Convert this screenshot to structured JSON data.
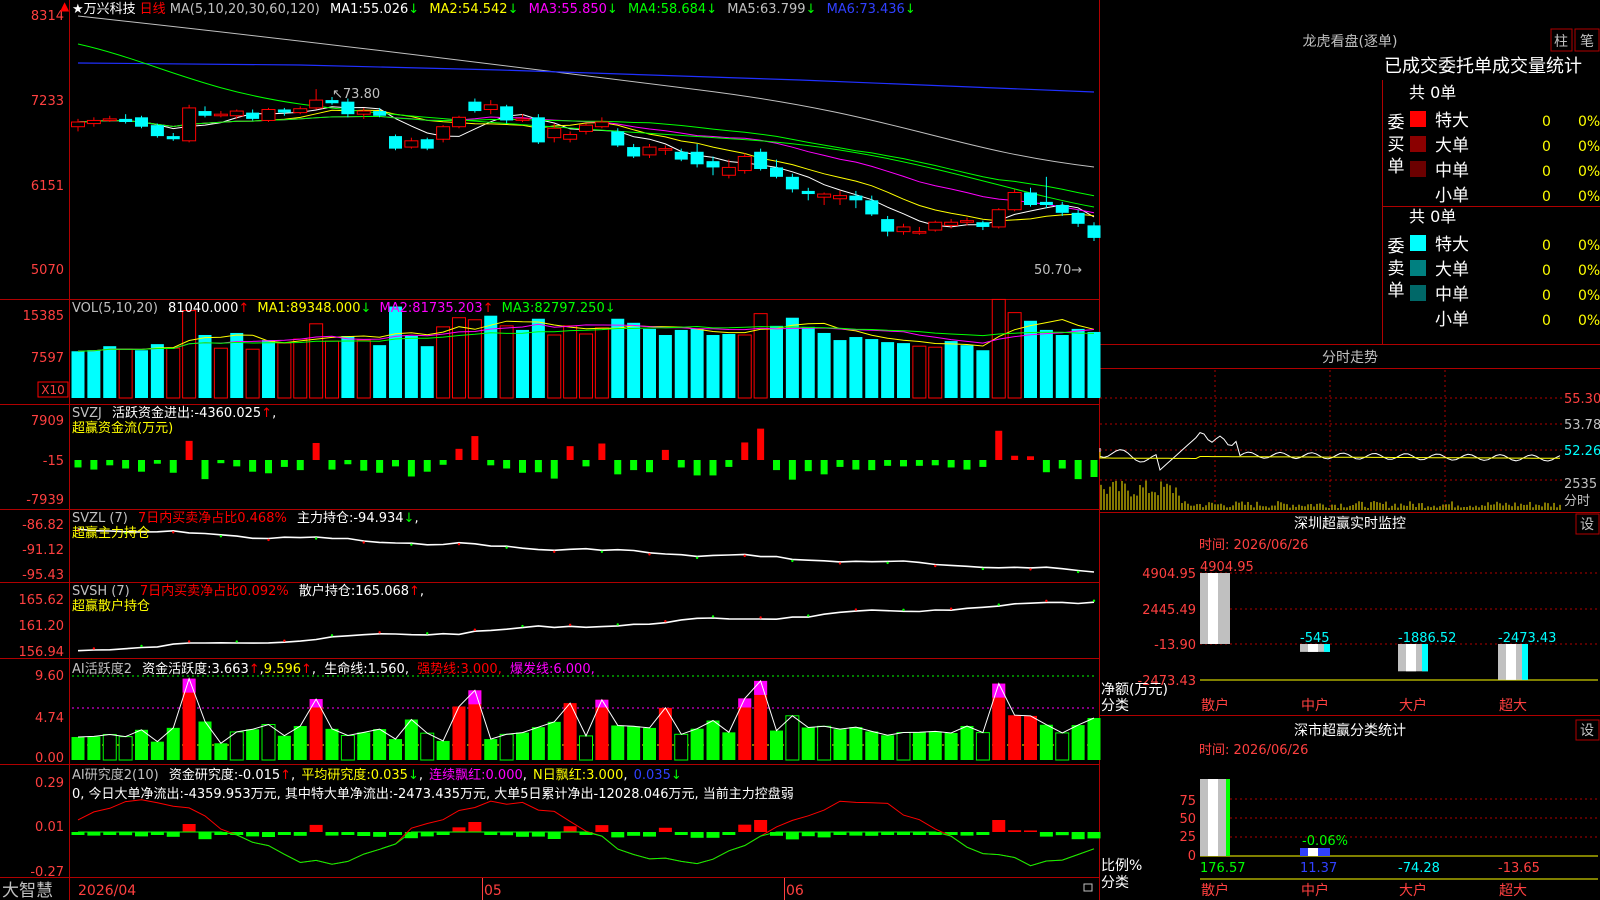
{
  "app": {
    "brand": "大智慧"
  },
  "stock": {
    "name": "万兴科技",
    "period": "日线",
    "star": "★"
  },
  "panels": {
    "price": {
      "legend_ma": "MA(5,10,20,30,60,120)",
      "ma": [
        {
          "label": "MA1:",
          "value": "55.026",
          "arrow": "↓",
          "color": "#ffffff"
        },
        {
          "label": "MA2:",
          "value": "54.542",
          "arrow": "↓",
          "color": "#ffff00"
        },
        {
          "label": "MA3:",
          "value": "55.850",
          "arrow": "↓",
          "color": "#ff00ff"
        },
        {
          "label": "MA4:",
          "value": "58.684",
          "arrow": "↓",
          "color": "#00ff00"
        },
        {
          "label": "MA5:",
          "value": "63.799",
          "arrow": "↓",
          "color": "#c0c0c0"
        },
        {
          "label": "MA6:",
          "value": "73.436",
          "arrow": "↓",
          "color": "#0000ff"
        }
      ],
      "yticks": [
        "8314",
        "7233",
        "6151",
        "5070"
      ],
      "high_note": "73.80",
      "low_note": "50.70"
    },
    "vol": {
      "legend": "VOL(5,10,20)",
      "value": "81040.000",
      "ma": [
        {
          "label": "MA1:",
          "value": "89348.000",
          "arrow": "↓",
          "color": "#ffff00"
        },
        {
          "label": "MA2:",
          "value": "81735.203",
          "arrow": "↑",
          "color": "#ff00ff"
        },
        {
          "label": "MA3:",
          "value": "82797.250",
          "arrow": "↓",
          "color": "#00ff00"
        }
      ],
      "yticks": [
        "15385",
        "7597"
      ],
      "unit": "X10"
    },
    "svzj": {
      "legend": "SVZJ",
      "label": "活跃资金进出:",
      "value": "-4360.025",
      "arrow": "↑",
      "subtitle": "超赢资金流(万元)",
      "yticks": [
        "7909",
        "-15",
        "-7939"
      ]
    },
    "svzl": {
      "legend": "SVZL (7)",
      "note": "7日内买卖净占比0.468%",
      "label": "主力持仓:",
      "value": "-94.934",
      "arrow": "↓",
      "subtitle": "超赢主力持仓",
      "yticks": [
        "-86.82",
        "-91.12",
        "-95.43"
      ]
    },
    "svsh": {
      "legend": "SVSH (7)",
      "note": "7日内买卖净占比0.092%",
      "label": "散户持仓:",
      "value": "165.068",
      "arrow": "↑",
      "subtitle": "超赢散户持仓",
      "yticks": [
        "165.62",
        "161.20",
        "156.94"
      ]
    },
    "ai_active": {
      "legend": "AI活跃度2",
      "label1": "资金活跃度:",
      "value1": "3.663",
      "arrow1": "↑",
      "value2": "9.596",
      "label3": "生命线:",
      "value3": "1.560",
      "label4": "强势线:",
      "value4": "3.000",
      "label5": "爆发线:",
      "value5": "6.000",
      "yticks": [
        "9.60",
        "4.74",
        "0.00"
      ]
    },
    "ai_research": {
      "legend": "AI研究度2(10)",
      "label1": "资金研究度:",
      "value1": "-0.015",
      "label2": "平均研究度:",
      "value2": "0.035",
      "label3": "连续飘红:",
      "value3": "0.000",
      "label4": "N日飘红:",
      "value4": "3.000",
      "value5": "0.035",
      "summary": "0, 今日大单净流出:-4359.953万元, 其中特大单净流出:-2473.435万元, 大单5日累计净出-12028.046万元, 当前主力控盘弱",
      "yticks": [
        "0.29",
        "0.01",
        "-0.27"
      ]
    }
  },
  "xaxis": [
    "2026/04",
    "05",
    "06"
  ],
  "sidebar": {
    "dragon_title": "龙虎看盘(逐单)",
    "btn_zhu": "柱",
    "btn_bi": "笔",
    "table_title": "已成交委托单成交量统计",
    "buy_label": "委买单",
    "sell_label": "委卖单",
    "buy_total": "共 0单",
    "sell_total": "共 0单",
    "rows": [
      {
        "label": "特大",
        "count": "0",
        "pct": "0%"
      },
      {
        "label": "大单",
        "count": "0",
        "pct": "0%"
      },
      {
        "label": "中单",
        "count": "0",
        "pct": "0%"
      },
      {
        "label": "小单",
        "count": "0",
        "pct": "0%"
      }
    ],
    "intraday_title": "分时走势",
    "intraday_ticks": [
      "55.30",
      "53.78",
      "52.26",
      "2535"
    ],
    "intraday_unit": "分时",
    "monitor_title": "深圳超赢实时监控",
    "monitor_btn": "设",
    "monitor_time": "时间: 2026/06/26",
    "monitor_yticks": [
      "4904.95",
      "2445.49",
      "-13.90",
      "-2473.43"
    ],
    "monitor_ylabel": "净额(万元)",
    "monitor_xlabel": "分类",
    "monitor_bars": [
      {
        "cat": "散户",
        "value": "4904.95"
      },
      {
        "cat": "中户",
        "value": "-545"
      },
      {
        "cat": "大户",
        "value": "-1886.52"
      },
      {
        "cat": "超大",
        "value": "-2473.43"
      }
    ],
    "class_title": "深市超赢分类统计",
    "class_btn": "设",
    "class_time": "时间: 2026/06/26",
    "class_yticks": [
      "75",
      "50",
      "25",
      "0"
    ],
    "class_ylabel": "比例%",
    "class_xlabel": "分类",
    "class_bars": [
      {
        "cat": "散户",
        "value": "176.57"
      },
      {
        "cat": "中户",
        "value": "11.37",
        "note": "-0.06%"
      },
      {
        "cat": "大户",
        "value": "-74.28"
      },
      {
        "cat": "超大",
        "value": "-13.65"
      }
    ]
  },
  "colors": {
    "up": "#ff0000",
    "down": "#00ffff",
    "grid": "#b00000"
  },
  "chart_data": {
    "type": "candlestick",
    "ylim": [
      50.0,
      83.14
    ],
    "candles": [
      [
        69.0,
        70.0,
        68.4,
        69.6
      ],
      [
        69.4,
        70.2,
        69.0,
        69.8
      ],
      [
        69.8,
        70.4,
        69.6,
        70.0
      ],
      [
        70.0,
        70.6,
        69.4,
        69.6
      ],
      [
        70.2,
        70.4,
        68.8,
        69.0
      ],
      [
        69.2,
        69.4,
        67.6,
        67.8
      ],
      [
        67.8,
        68.2,
        67.2,
        67.4
      ],
      [
        67.2,
        71.8,
        67.0,
        71.4
      ],
      [
        71.0,
        71.6,
        70.2,
        70.4
      ],
      [
        70.4,
        71.0,
        70.2,
        70.6
      ],
      [
        70.4,
        71.2,
        70.0,
        71.0
      ],
      [
        70.8,
        71.2,
        69.8,
        70.0
      ],
      [
        69.8,
        71.4,
        69.6,
        71.2
      ],
      [
        71.2,
        71.4,
        70.4,
        70.8
      ],
      [
        70.8,
        71.6,
        70.6,
        71.3
      ],
      [
        71.4,
        73.8,
        71.2,
        72.4
      ],
      [
        72.4,
        72.8,
        71.8,
        72.0
      ],
      [
        72.2,
        72.6,
        70.2,
        70.6
      ],
      [
        70.6,
        71.4,
        70.0,
        71.0
      ],
      [
        71.0,
        71.4,
        70.2,
        70.4
      ],
      [
        67.8,
        68.0,
        66.0,
        66.2
      ],
      [
        66.4,
        67.6,
        66.2,
        67.2
      ],
      [
        67.4,
        67.6,
        66.0,
        66.2
      ],
      [
        67.4,
        69.2,
        67.0,
        69.0
      ],
      [
        69.0,
        70.4,
        68.8,
        70.2
      ],
      [
        72.2,
        72.6,
        70.8,
        71.0
      ],
      [
        71.2,
        72.4,
        70.6,
        71.8
      ],
      [
        71.6,
        71.8,
        69.4,
        69.8
      ],
      [
        70.0,
        70.6,
        69.6,
        70.0
      ],
      [
        70.2,
        70.6,
        66.8,
        67.0
      ],
      [
        67.6,
        69.4,
        67.0,
        68.8
      ],
      [
        67.4,
        68.4,
        67.0,
        68.0
      ],
      [
        68.4,
        69.4,
        68.0,
        69.2
      ],
      [
        69.0,
        70.2,
        68.8,
        69.6
      ],
      [
        68.4,
        68.8,
        66.4,
        66.6
      ],
      [
        66.4,
        66.8,
        65.0,
        65.2
      ],
      [
        65.4,
        66.8,
        65.0,
        66.4
      ],
      [
        66.0,
        66.6,
        65.4,
        66.2
      ],
      [
        65.8,
        66.2,
        64.6,
        64.8
      ],
      [
        65.8,
        66.8,
        63.8,
        64.2
      ],
      [
        64.6,
        65.2,
        62.8,
        63.8
      ],
      [
        62.8,
        64.8,
        62.4,
        63.8
      ],
      [
        63.4,
        65.6,
        63.0,
        65.2
      ],
      [
        65.8,
        66.2,
        63.4,
        63.6
      ],
      [
        63.8,
        64.8,
        62.4,
        62.6
      ],
      [
        62.6,
        63.0,
        60.6,
        61.0
      ],
      [
        60.8,
        61.2,
        59.6,
        60.4
      ],
      [
        60.0,
        60.6,
        59.0,
        60.4
      ],
      [
        59.8,
        60.8,
        59.0,
        60.2
      ],
      [
        60.2,
        60.8,
        58.6,
        59.6
      ],
      [
        59.6,
        60.2,
        57.6,
        57.8
      ],
      [
        57.2,
        57.6,
        55.0,
        55.6
      ],
      [
        55.6,
        56.6,
        55.2,
        56.2
      ],
      [
        55.6,
        56.2,
        55.2,
        55.6
      ],
      [
        55.8,
        57.0,
        55.6,
        56.8
      ],
      [
        56.4,
        57.2,
        56.0,
        56.8
      ],
      [
        56.8,
        57.4,
        56.4,
        57.0
      ],
      [
        56.8,
        57.0,
        55.8,
        56.2
      ],
      [
        56.2,
        58.6,
        56.0,
        58.4
      ],
      [
        58.4,
        61.0,
        58.2,
        60.6
      ],
      [
        60.6,
        61.2,
        58.8,
        59.0
      ],
      [
        59.4,
        62.6,
        58.6,
        59.0
      ],
      [
        59.0,
        59.4,
        57.6,
        58.0
      ],
      [
        58.0,
        58.4,
        56.2,
        56.6
      ],
      [
        56.4,
        56.8,
        54.4,
        54.8
      ]
    ],
    "volume_k": [
      [
        9.2,
        0
      ],
      [
        9.4,
        0
      ],
      [
        10.2,
        0
      ],
      [
        9.6,
        1
      ],
      [
        9.4,
        0
      ],
      [
        10.6,
        0
      ],
      [
        9.8,
        1
      ],
      [
        17.2,
        1
      ],
      [
        12.4,
        0
      ],
      [
        9.8,
        1
      ],
      [
        12.8,
        0
      ],
      [
        9.6,
        1
      ],
      [
        11.4,
        0
      ],
      [
        10.8,
        1
      ],
      [
        11.6,
        1
      ],
      [
        14.6,
        1
      ],
      [
        11.2,
        1
      ],
      [
        12.2,
        0
      ],
      [
        11.4,
        1
      ],
      [
        10.4,
        0
      ],
      [
        18.0,
        0
      ],
      [
        12.2,
        0
      ],
      [
        10.2,
        0
      ],
      [
        14.0,
        1
      ],
      [
        15.8,
        1
      ],
      [
        15.4,
        1
      ],
      [
        16.2,
        0
      ],
      [
        14.2,
        1
      ],
      [
        13.4,
        0
      ],
      [
        15.6,
        0
      ],
      [
        12.4,
        1
      ],
      [
        14.2,
        1
      ],
      [
        12.6,
        1
      ],
      [
        13.8,
        1
      ],
      [
        15.6,
        0
      ],
      [
        14.8,
        0
      ],
      [
        13.6,
        0
      ],
      [
        12.4,
        0
      ],
      [
        13.4,
        0
      ],
      [
        13.6,
        0
      ],
      [
        12.4,
        0
      ],
      [
        12.6,
        0
      ],
      [
        12.4,
        1
      ],
      [
        16.6,
        1
      ],
      [
        14.2,
        0
      ],
      [
        15.8,
        0
      ],
      [
        14.0,
        0
      ],
      [
        12.8,
        0
      ],
      [
        11.4,
        0
      ],
      [
        12.0,
        0
      ],
      [
        11.6,
        0
      ],
      [
        11.0,
        0
      ],
      [
        10.8,
        0
      ],
      [
        10.2,
        1
      ],
      [
        10.0,
        1
      ],
      [
        11.2,
        0
      ],
      [
        10.4,
        0
      ],
      [
        9.4,
        0
      ],
      [
        19.4,
        1
      ],
      [
        16.8,
        1
      ],
      [
        15.2,
        0
      ],
      [
        13.4,
        0
      ],
      [
        12.4,
        0
      ],
      [
        13.6,
        0
      ],
      [
        13.0,
        0
      ]
    ],
    "svzj": [
      -1400,
      -1800,
      -1000,
      -1600,
      -2200,
      -700,
      -2400,
      3600,
      -3600,
      -600,
      -1200,
      -2200,
      -2500,
      -1300,
      -1900,
      3200,
      -1800,
      -800,
      -2000,
      -2400,
      -1200,
      -3100,
      -2200,
      -900,
      2100,
      4500,
      -1000,
      -1600,
      -2400,
      -2300,
      -3500,
      2600,
      -1200,
      3100,
      -2700,
      -1900,
      -2300,
      1900,
      -1400,
      -2900,
      -2900,
      -1300,
      3300,
      5900,
      -1900,
      -3700,
      -2100,
      -2700,
      -1300,
      -1800,
      -1900,
      -1100,
      -1200,
      -1100,
      -1000,
      -1400,
      -1800,
      -1300,
      5500,
      800,
      700,
      -2300,
      -1600,
      -3600,
      -3200
    ]
  }
}
